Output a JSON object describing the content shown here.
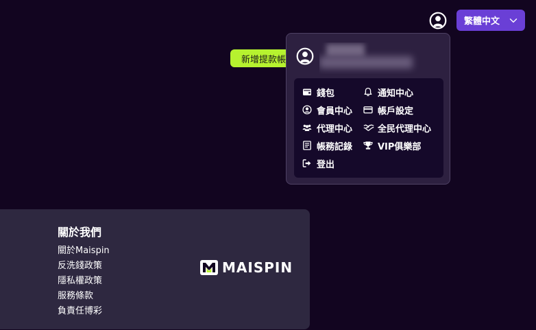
{
  "header": {
    "language_label": "繁體中文",
    "user_icon": "user-circle-icon",
    "language_chevron_icon": "chevron-down-icon"
  },
  "green_button": {
    "label": "新增提款帳號"
  },
  "user_menu": {
    "avatar_icon": "user-circle-icon",
    "username": "",
    "items": [
      {
        "label": "錢包",
        "icon": "wallet-icon"
      },
      {
        "label": "通知中心",
        "icon": "bell-icon"
      },
      {
        "label": "會員中心",
        "icon": "user-circle-icon"
      },
      {
        "label": "帳戶設定",
        "icon": "credit-card-icon"
      },
      {
        "label": "代理中心",
        "icon": "users-icon"
      },
      {
        "label": "全民代理中心",
        "icon": "handshake-icon"
      },
      {
        "label": "帳務記錄",
        "icon": "ledger-icon"
      },
      {
        "label": "VIP俱樂部",
        "icon": "trophy-icon"
      },
      {
        "label": "登出",
        "icon": "logout-icon"
      }
    ]
  },
  "footer": {
    "title": "關於我們",
    "links": [
      "關於Maispin",
      "反洗錢政策",
      "隱私權政策",
      "服務條款",
      "負責任博彩"
    ],
    "logo_text": "MAISPIN",
    "logo_icon": "maispin-logo-icon"
  },
  "colors": {
    "background": "#120520",
    "accent_purple": "#6a3fd6",
    "accent_green": "#b6f22f",
    "dropdown_bg": "#2d2040",
    "menu_bg": "#15092a",
    "footer_bg": "#2e2840"
  }
}
